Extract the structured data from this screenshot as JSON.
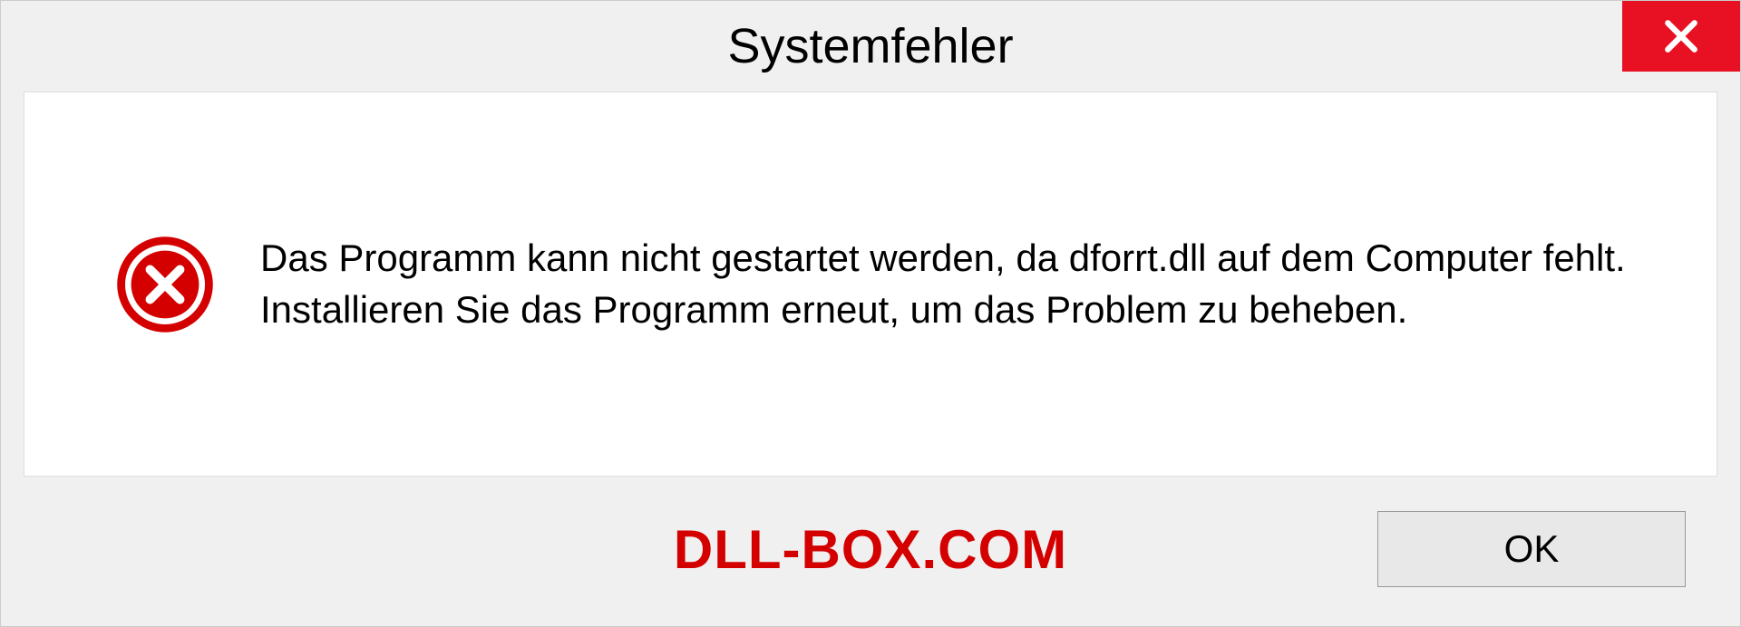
{
  "dialog": {
    "title": "Systemfehler",
    "message": "Das Programm kann nicht gestartet werden, da dforrt.dll auf dem Computer fehlt. Installieren Sie das Programm erneut, um das Problem zu beheben.",
    "ok_label": "OK"
  },
  "watermark": "DLL-BOX.COM"
}
